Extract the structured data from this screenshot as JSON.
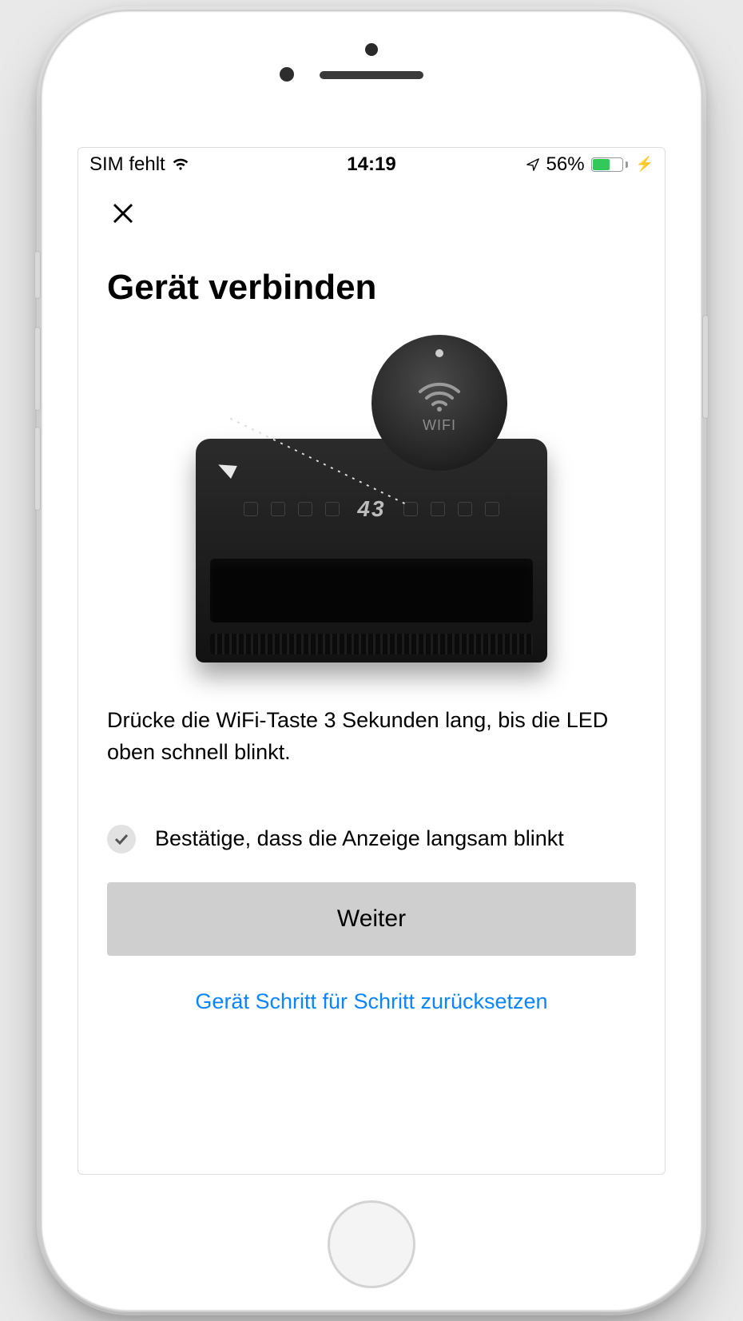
{
  "status_bar": {
    "carrier": "SIM fehlt",
    "time": "14:19",
    "battery_percent": "56%"
  },
  "screen": {
    "title": "Gerät verbinden",
    "device_number": "43",
    "wifi_bubble_label": "WIFI",
    "instruction": "Drücke die WiFi-Taste 3 Sekunden lang, bis die LED oben schnell blinkt.",
    "confirm_label": "Bestätige, dass die Anzeige langsam blinkt",
    "primary_button": "Weiter",
    "reset_link": "Gerät Schritt für Schritt zurücksetzen"
  }
}
